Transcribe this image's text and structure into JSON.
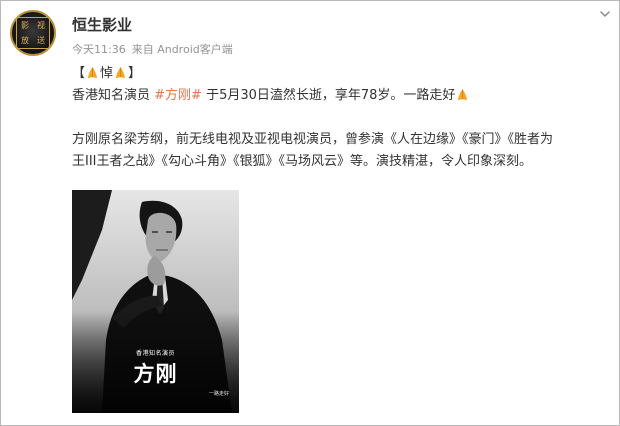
{
  "post": {
    "author": "恒生影业",
    "avatar_text": [
      "影",
      "视",
      "放",
      "送"
    ],
    "time": "今天11:36",
    "source": "来自 Android客户端"
  },
  "content": {
    "line1_open": "【",
    "line1_word": "悼",
    "line1_close": "】",
    "line2_pre": "香港知名演员 ",
    "line2_tag": "#方刚#",
    "line2_post": " 于5月30日溘然长逝，享年78岁。一路走好",
    "para_line1": "方刚原名梁芳纲，前无线电视及亚视电视演员，曾参演《人在边缘》《豪门》《胜者为",
    "para_line2": "王III王者之战》《勾心斗角》《银狐》《马场风云》等。演技精湛，令人印象深刻。"
  },
  "image": {
    "subtitle": "香港知名演员",
    "name": "方刚",
    "tagline": "一路走好"
  },
  "icons": {
    "pray": "folded-hands-emoji",
    "menu": "chevron-down-icon"
  },
  "colors": {
    "hashtag": "#eb7350",
    "pray": "#f5a623"
  }
}
